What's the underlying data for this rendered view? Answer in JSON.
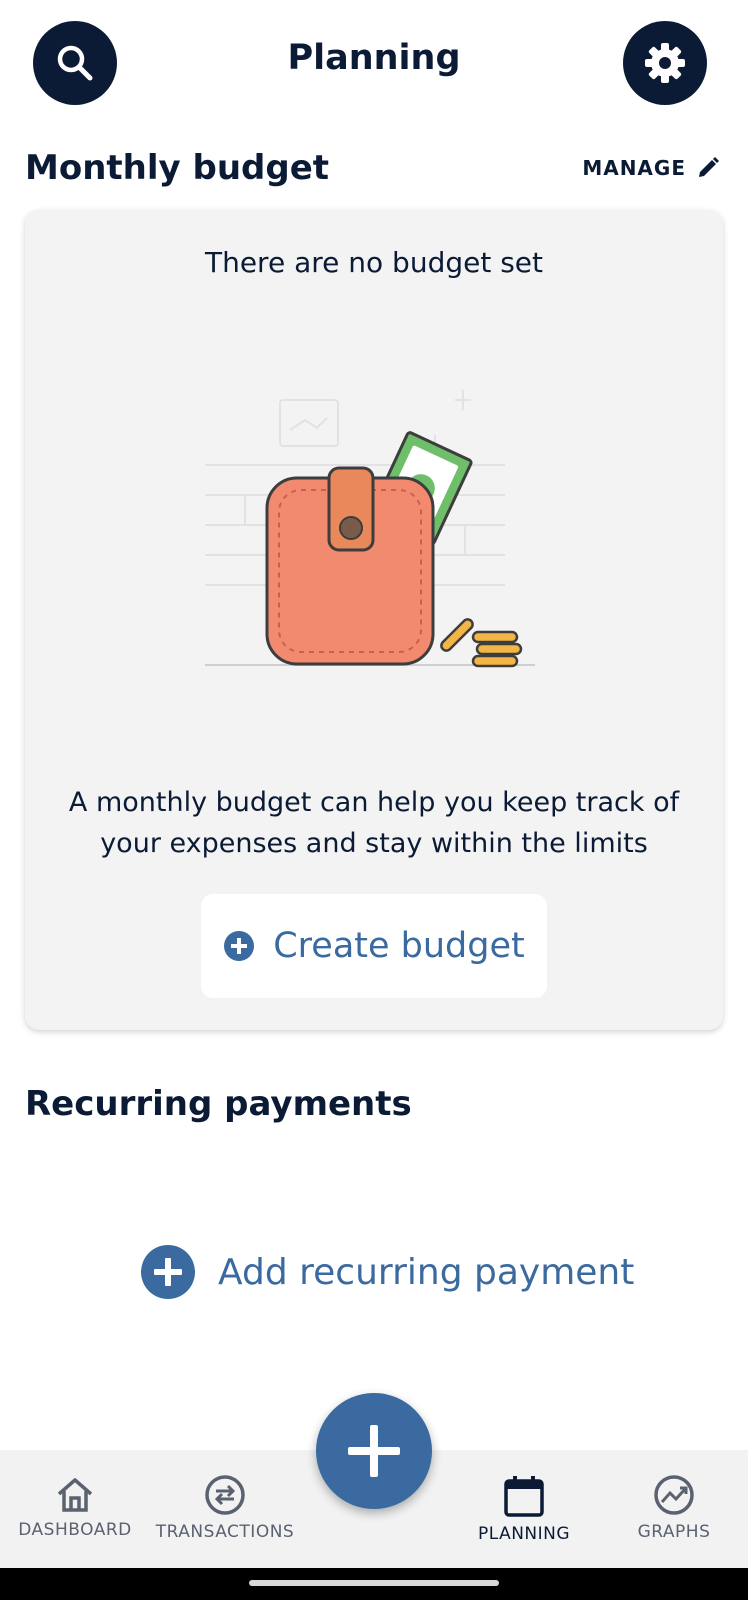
{
  "header": {
    "title": "Planning",
    "search_icon": "search-icon",
    "settings_icon": "gear-icon"
  },
  "monthly_budget": {
    "title": "Monthly budget",
    "manage_label": "MANAGE",
    "empty_text": "There are no budget set",
    "description": "A monthly budget can help you keep track of your expenses and stay within the limits",
    "create_label": "Create budget"
  },
  "recurring": {
    "title": "Recurring payments",
    "add_label": "Add recurring payment"
  },
  "nav": {
    "items": [
      {
        "label": "DASHBOARD",
        "icon": "home-icon"
      },
      {
        "label": "TRANSACTIONS",
        "icon": "transfer-icon"
      },
      {
        "label": "PLANNING",
        "icon": "calendar-icon",
        "active": true
      },
      {
        "label": "GRAPHS",
        "icon": "graph-icon"
      }
    ]
  },
  "colors": {
    "navy": "#0c1b35",
    "accent": "#3a6aa0",
    "card_bg": "#f3f3f4",
    "wallet": "#f28a70"
  }
}
